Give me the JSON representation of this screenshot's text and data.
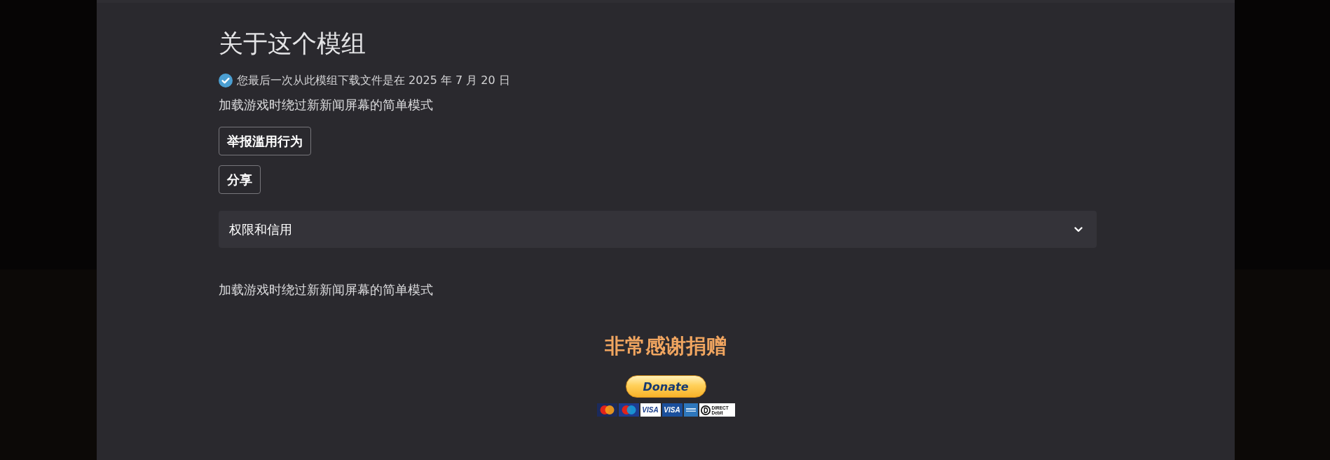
{
  "about": {
    "title": "关于这个模组",
    "download_note": "您最后一次从此模组下载文件是在 2025 年 7 月 20 日",
    "summary": "加载游戏时绕过新新闻屏幕的简单模式",
    "buttons": [
      "举报滥用行为",
      "分享"
    ]
  },
  "permissions": {
    "label": "权限和信用",
    "expanded": false
  },
  "description": "加载游戏时绕过新新闻屏幕的简单模式",
  "donation": {
    "heading": "非常感谢捐赠",
    "button": "Donate",
    "cards": [
      {
        "kind": "mastercard",
        "color": "#1b2a5c"
      },
      {
        "kind": "maestro",
        "color": "#1d3b8f"
      },
      {
        "kind": "visa",
        "color": "#ffffff",
        "label": "VISA"
      },
      {
        "kind": "visa",
        "color": "#1a4f9c",
        "label": "VISA"
      },
      {
        "kind": "amex",
        "color": "#2e77bc"
      },
      {
        "kind": "debit",
        "color": "#ffffff",
        "label": "DIRECT Debit"
      }
    ]
  }
}
